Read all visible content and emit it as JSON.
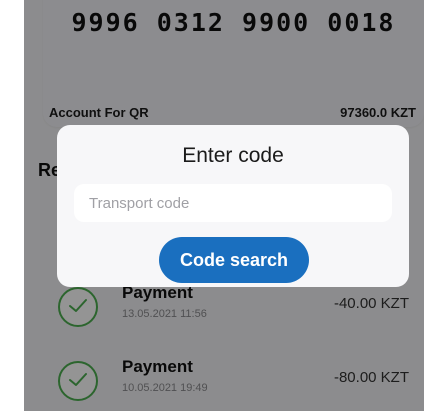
{
  "card": {
    "number": "9996 0312 9900 0018",
    "account_label": "Account For QR",
    "balance": "97360.0 KZT"
  },
  "section": {
    "title": "Recent"
  },
  "transactions": [
    {
      "title": "Payment",
      "date": "13.05.2021 11:56",
      "amount": "-40.00 KZT",
      "icon": "check-circle-icon"
    },
    {
      "title": "Payment",
      "date": "10.05.2021 19:49",
      "amount": "-80.00 KZT",
      "icon": "check-circle-icon"
    }
  ],
  "dialog": {
    "title": "Enter code",
    "input_placeholder": "Transport code",
    "input_value": "",
    "button_label": "Code search"
  },
  "colors": {
    "accent": "#1a6fbf",
    "success": "#4caf50",
    "overlay": "rgba(0,0,0,0.42)"
  }
}
